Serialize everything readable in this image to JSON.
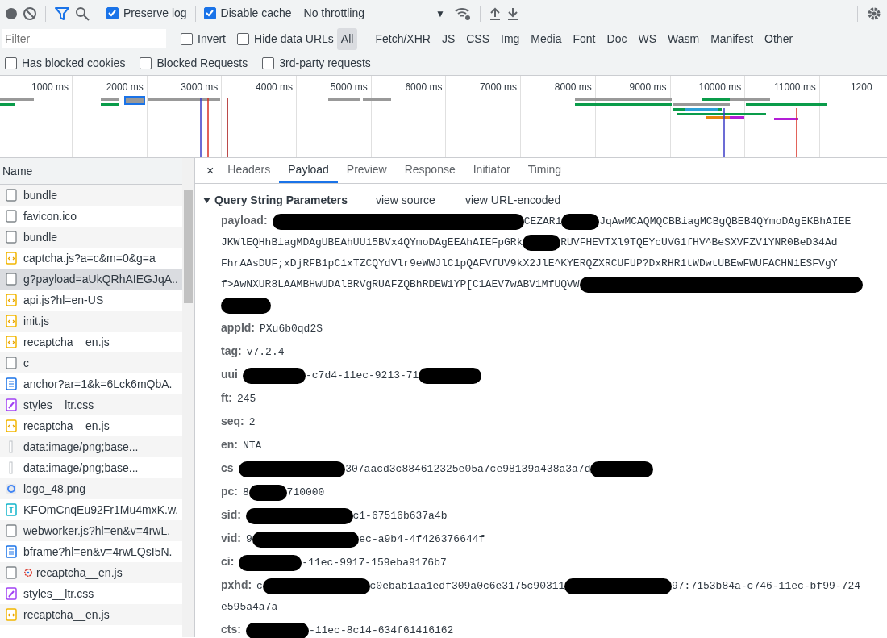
{
  "toolbar": {
    "record_on": false,
    "filter_active": true,
    "preserve_log": {
      "label": "Preserve log",
      "checked": true
    },
    "disable_cache": {
      "label": "Disable cache",
      "checked": true
    },
    "throttling": {
      "value": "No throttling",
      "caret": "▼"
    }
  },
  "filter_bar": {
    "placeholder": "Filter",
    "invert": {
      "label": "Invert",
      "checked": false
    },
    "hide_data_urls": {
      "label": "Hide data URLs",
      "checked": false
    },
    "types": [
      {
        "label": "All",
        "selected": true
      },
      {
        "label": "Fetch/XHR",
        "selected": false
      },
      {
        "label": "JS",
        "selected": false
      },
      {
        "label": "CSS",
        "selected": false
      },
      {
        "label": "Img",
        "selected": false
      },
      {
        "label": "Media",
        "selected": false
      },
      {
        "label": "Font",
        "selected": false
      },
      {
        "label": "Doc",
        "selected": false
      },
      {
        "label": "WS",
        "selected": false
      },
      {
        "label": "Wasm",
        "selected": false
      },
      {
        "label": "Manifest",
        "selected": false
      },
      {
        "label": "Other",
        "selected": false
      }
    ]
  },
  "extra_filters": [
    {
      "label": "Has blocked cookies",
      "checked": false
    },
    {
      "label": "Blocked Requests",
      "checked": false
    },
    {
      "label": "3rd-party requests",
      "checked": false
    }
  ],
  "overview": {
    "ticks": [
      "1000 ms",
      "2000 ms",
      "3000 ms",
      "4000 ms",
      "5000 ms",
      "6000 ms",
      "7000 ms",
      "8000 ms",
      "9000 ms",
      "10000 ms",
      "11000 ms",
      "1200"
    ]
  },
  "requests": {
    "column": "Name",
    "rows": [
      {
        "name": "bundle",
        "kind": "other",
        "selected": false,
        "worker": false
      },
      {
        "name": "favicon.ico",
        "kind": "other",
        "selected": false,
        "worker": false
      },
      {
        "name": "bundle",
        "kind": "other",
        "selected": false,
        "worker": false
      },
      {
        "name": "captcha.js?a=c&m=0&g=a",
        "kind": "script",
        "selected": false,
        "worker": false
      },
      {
        "name": "g?payload=aUkQRhAIEGJqA..",
        "kind": "other",
        "selected": true,
        "worker": false
      },
      {
        "name": "api.js?hl=en-US",
        "kind": "script",
        "selected": false,
        "worker": false
      },
      {
        "name": "init.js",
        "kind": "script",
        "selected": false,
        "worker": false
      },
      {
        "name": "recaptcha__en.js",
        "kind": "script",
        "selected": false,
        "worker": false
      },
      {
        "name": "c",
        "kind": "other",
        "selected": false,
        "worker": false
      },
      {
        "name": "anchor?ar=1&k=6Lck6mQbA.",
        "kind": "document",
        "selected": false,
        "worker": false
      },
      {
        "name": "styles__ltr.css",
        "kind": "stylesheet",
        "selected": false,
        "worker": false
      },
      {
        "name": "recaptcha__en.js",
        "kind": "script",
        "selected": false,
        "worker": false
      },
      {
        "name": "data:image/png;base...",
        "kind": "data",
        "selected": false,
        "worker": false
      },
      {
        "name": "data:image/png;base...",
        "kind": "data",
        "selected": false,
        "worker": false
      },
      {
        "name": "logo_48.png",
        "kind": "image",
        "selected": false,
        "worker": false
      },
      {
        "name": "KFOmCnqEu92Fr1Mu4mxK.w.",
        "kind": "font",
        "selected": false,
        "worker": false
      },
      {
        "name": "webworker.js?hl=en&v=4rwL.",
        "kind": "other",
        "selected": false,
        "worker": false
      },
      {
        "name": "bframe?hl=en&v=4rwLQsI5N.",
        "kind": "document",
        "selected": false,
        "worker": false
      },
      {
        "name": "recaptcha__en.js",
        "kind": "other",
        "selected": false,
        "worker": true
      },
      {
        "name": "styles__ltr.css",
        "kind": "stylesheet",
        "selected": false,
        "worker": false
      },
      {
        "name": "recaptcha__en.js",
        "kind": "script",
        "selected": false,
        "worker": false
      }
    ]
  },
  "detail": {
    "close": "×",
    "tabs": [
      {
        "label": "Headers",
        "selected": false
      },
      {
        "label": "Payload",
        "selected": true
      },
      {
        "label": "Preview",
        "selected": false
      },
      {
        "label": "Response",
        "selected": false
      },
      {
        "label": "Initiator",
        "selected": false
      },
      {
        "label": "Timing",
        "selected": false
      }
    ],
    "section": {
      "title": "Query String Parameters",
      "expanded": true,
      "links": [
        "view source",
        "view URL-encoded"
      ],
      "params": [
        {
          "key": "payload:",
          "parts": [
            {
              "kind": "redaction"
            },
            {
              "kind": "text",
              "text": "CEZAR1"
            },
            {
              "kind": "redaction"
            },
            {
              "kind": "text",
              "text": "JqAwMCAQMQCBBiagMCBgQBEB4QYmoDAgEKBhAIEE"
            },
            {
              "kind": "text",
              "text": "JKWlEQHhBiagMDAgUBEAhUU15BVx4QYmoDAgEEAhAIEFpGRk"
            },
            {
              "kind": "redaction"
            },
            {
              "kind": "text",
              "text": "RUVFHEVTXl9TQEYcUVG1fHV^BeSXVFZV1YNR0BeD34Ad"
            },
            {
              "kind": "text",
              "text": "FhrAAsDUF;xDjRFB1pC1xTZCQYdVlr9eWWJlC1pQAFVfUV9kX2JlE^KYERQZXRCUFUP?DxRHR1tWDwtUBEwFWUFACHN1ESFVgY"
            },
            {
              "kind": "text",
              "text": "f>AwNXUR8LAAMBHwUDAlBRVgRUAFZQBhRDEW1YP[C1AEV7wABV1MfUQVW"
            },
            {
              "kind": "redaction"
            },
            {
              "kind": "redaction"
            }
          ]
        },
        {
          "key": "appId:",
          "parts": [
            {
              "kind": "text",
              "text": "PXu6b0qd2S"
            }
          ]
        },
        {
          "key": "tag:",
          "parts": [
            {
              "kind": "text",
              "text": "v7.2.4"
            }
          ]
        },
        {
          "key": "uui",
          "parts": [
            {
              "kind": "redaction"
            },
            {
              "kind": "text",
              "text": "-c7d4-11ec-9213-71"
            },
            {
              "kind": "redaction"
            }
          ]
        },
        {
          "key": "ft:",
          "parts": [
            {
              "kind": "text",
              "text": "245"
            }
          ]
        },
        {
          "key": "seq:",
          "parts": [
            {
              "kind": "text",
              "text": "2"
            }
          ]
        },
        {
          "key": "en:",
          "parts": [
            {
              "kind": "text",
              "text": "NTA"
            }
          ]
        },
        {
          "key": "cs",
          "parts": [
            {
              "kind": "redaction"
            },
            {
              "kind": "text",
              "text": "307aacd3c884612325e05a7ce98139a438a3a7d"
            },
            {
              "kind": "redaction"
            }
          ]
        },
        {
          "key": "pc:",
          "parts": [
            {
              "kind": "text",
              "text": "8"
            },
            {
              "kind": "redaction"
            },
            {
              "kind": "text",
              "text": "710000"
            }
          ]
        },
        {
          "key": "sid:",
          "parts": [
            {
              "kind": "redaction"
            },
            {
              "kind": "text",
              "text": "c1-67516b637a4b"
            }
          ]
        },
        {
          "key": "vid:",
          "parts": [
            {
              "kind": "text",
              "text": "9"
            },
            {
              "kind": "redaction"
            },
            {
              "kind": "text",
              "text": "ec-a9b4-4f426376644f"
            }
          ]
        },
        {
          "key": "ci:",
          "parts": [
            {
              "kind": "redaction"
            },
            {
              "kind": "text",
              "text": "-11ec-9917-159eba9176b7"
            }
          ]
        },
        {
          "key": "pxhd:",
          "parts": [
            {
              "kind": "text",
              "text": "c"
            },
            {
              "kind": "redaction"
            },
            {
              "kind": "text",
              "text": "c0ebab1aa1edf309a0c6e3175c90311"
            },
            {
              "kind": "redaction"
            },
            {
              "kind": "text",
              "text": "97:7153b84a-c746-11ec-bf99-724"
            },
            {
              "kind": "text",
              "text": "e595a4a7a"
            }
          ]
        },
        {
          "key": "cts:",
          "parts": [
            {
              "kind": "redaction"
            },
            {
              "kind": "text",
              "text": "-11ec-8c14-634f61416162"
            }
          ]
        }
      ]
    }
  }
}
